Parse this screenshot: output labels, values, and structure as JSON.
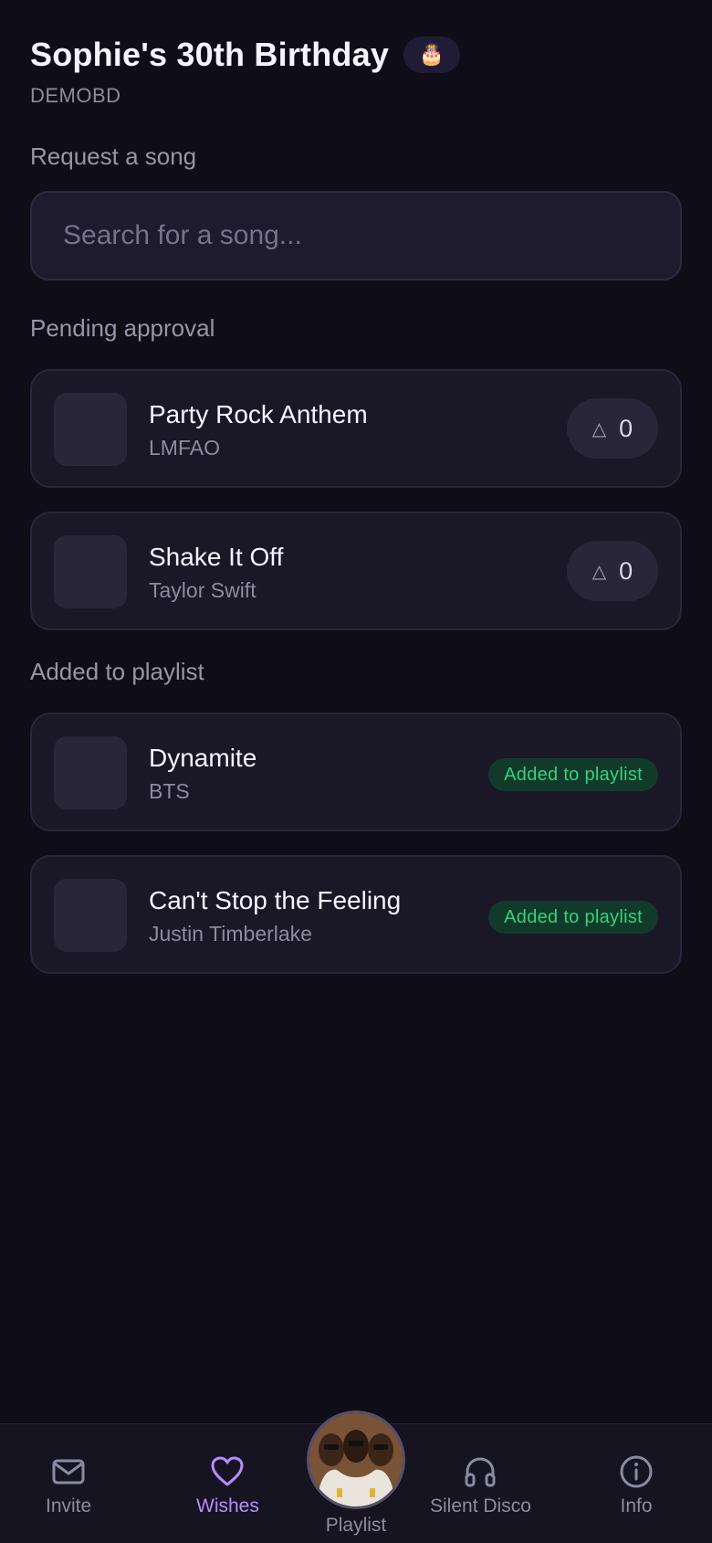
{
  "header": {
    "title": "Sophie's 30th Birthday",
    "emoji": "🎂",
    "code": "DEMOBD"
  },
  "request": {
    "label": "Request a song",
    "placeholder": "Search for a song..."
  },
  "pending": {
    "label": "Pending approval",
    "items": [
      {
        "title": "Party Rock Anthem",
        "artist": "LMFAO",
        "votes": "0"
      },
      {
        "title": "Shake It Off",
        "artist": "Taylor Swift",
        "votes": "0"
      }
    ]
  },
  "added": {
    "label": "Added to playlist",
    "items": [
      {
        "title": "Dynamite",
        "artist": "BTS",
        "badge": "Added to playlist"
      },
      {
        "title": "Can't Stop the Feeling",
        "artist": "Justin Timberlake",
        "badge": "Added to playlist"
      }
    ]
  },
  "vote_icon": "△",
  "nav": {
    "invite": "Invite",
    "wishes": "Wishes",
    "playlist": "Playlist",
    "silent_disco": "Silent Disco",
    "info": "Info",
    "active": "wishes"
  },
  "colors": {
    "background": "#0f0d18",
    "accent": "#b58cff",
    "success": "#34d27a"
  }
}
